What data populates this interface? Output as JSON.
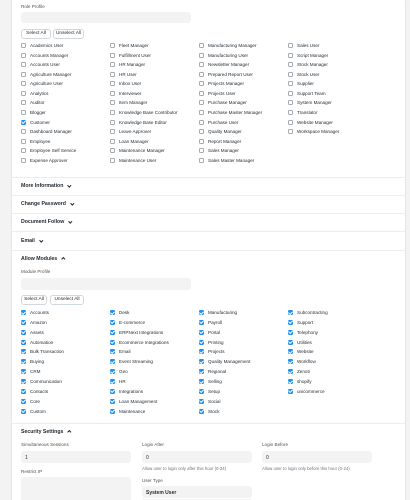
{
  "role_profile": {
    "label": "Role Profile",
    "value": ""
  },
  "role_buttons": {
    "select_all": "Select All",
    "unselect_all": "Unselect All"
  },
  "roles": [
    [
      {
        "label": "Academics User",
        "checked": false
      },
      {
        "label": "Accounts Manager",
        "checked": false
      },
      {
        "label": "Accounts User",
        "checked": false
      },
      {
        "label": "Agriculture Manager",
        "checked": false
      },
      {
        "label": "Agriculture User",
        "checked": false
      },
      {
        "label": "Analytics",
        "checked": false
      },
      {
        "label": "Auditor",
        "checked": false
      },
      {
        "label": "Blogger",
        "checked": false
      },
      {
        "label": "Customer",
        "checked": true
      },
      {
        "label": "Dashboard Manager",
        "checked": false
      },
      {
        "label": "Employee",
        "checked": false
      },
      {
        "label": "Employee Self Service",
        "checked": false
      },
      {
        "label": "Expense Approver",
        "checked": false
      }
    ],
    [
      {
        "label": "Fleet Manager",
        "checked": false
      },
      {
        "label": "Fulfillment User",
        "checked": false
      },
      {
        "label": "HR Manager",
        "checked": false
      },
      {
        "label": "HR User",
        "checked": false
      },
      {
        "label": "Inbox User",
        "checked": false
      },
      {
        "label": "Interviewer",
        "checked": false
      },
      {
        "label": "Item Manager",
        "checked": false
      },
      {
        "label": "Knowledge Base Contributor",
        "checked": false
      },
      {
        "label": "Knowledge Base Editor",
        "checked": false
      },
      {
        "label": "Leave Approver",
        "checked": false
      },
      {
        "label": "Loan Manager",
        "checked": false
      },
      {
        "label": "Maintenance Manager",
        "checked": false
      },
      {
        "label": "Maintenance User",
        "checked": false
      }
    ],
    [
      {
        "label": "Manufacturing Manager",
        "checked": false
      },
      {
        "label": "Manufacturing User",
        "checked": false
      },
      {
        "label": "Newsletter Manager",
        "checked": false
      },
      {
        "label": "Prepared Report User",
        "checked": false
      },
      {
        "label": "Projects Manager",
        "checked": false
      },
      {
        "label": "Projects User",
        "checked": false
      },
      {
        "label": "Purchase Manager",
        "checked": false
      },
      {
        "label": "Purchase Master Manager",
        "checked": false
      },
      {
        "label": "Purchase User",
        "checked": false
      },
      {
        "label": "Quality Manager",
        "checked": false
      },
      {
        "label": "Report Manager",
        "checked": false
      },
      {
        "label": "Sales Manager",
        "checked": false
      },
      {
        "label": "Sales Master Manager",
        "checked": false
      }
    ],
    [
      {
        "label": "Sales User",
        "checked": false
      },
      {
        "label": "Script Manager",
        "checked": false
      },
      {
        "label": "Stock Manager",
        "checked": false
      },
      {
        "label": "Stock User",
        "checked": false
      },
      {
        "label": "Supplier",
        "checked": false
      },
      {
        "label": "Support Team",
        "checked": false
      },
      {
        "label": "System Manager",
        "checked": false
      },
      {
        "label": "Translator",
        "checked": false
      },
      {
        "label": "Website Manager",
        "checked": false
      },
      {
        "label": "Workspace Manager",
        "checked": false
      }
    ]
  ],
  "sections": {
    "more_information": "More Information",
    "change_password": "Change Password",
    "document_follow": "Document Follow",
    "email": "Email",
    "allow_modules": "Allow Modules",
    "security_settings": "Security Settings"
  },
  "module_profile": {
    "label": "Module Profile",
    "value": ""
  },
  "module_buttons": {
    "select_all": "Select All",
    "unselect_all": "Unselect All"
  },
  "modules": [
    [
      {
        "label": "Accounts",
        "checked": true
      },
      {
        "label": "Amazon",
        "checked": true
      },
      {
        "label": "Assets",
        "checked": true
      },
      {
        "label": "Automation",
        "checked": true
      },
      {
        "label": "Bulk Transaction",
        "checked": true
      },
      {
        "label": "Buying",
        "checked": true
      },
      {
        "label": "CRM",
        "checked": true
      },
      {
        "label": "Communication",
        "checked": true
      },
      {
        "label": "Contacts",
        "checked": true
      },
      {
        "label": "Core",
        "checked": true
      },
      {
        "label": "Custom",
        "checked": true
      }
    ],
    [
      {
        "label": "Desk",
        "checked": true
      },
      {
        "label": "E-commerce",
        "checked": true
      },
      {
        "label": "ERPNext Integrations",
        "checked": true
      },
      {
        "label": "Ecommerce Integrations",
        "checked": true
      },
      {
        "label": "Email",
        "checked": true
      },
      {
        "label": "Event Streaming",
        "checked": true
      },
      {
        "label": "Geo",
        "checked": true
      },
      {
        "label": "HR",
        "checked": true
      },
      {
        "label": "Integrations",
        "checked": true
      },
      {
        "label": "Loan Management",
        "checked": true
      },
      {
        "label": "Maintenance",
        "checked": true
      }
    ],
    [
      {
        "label": "Manufacturing",
        "checked": true
      },
      {
        "label": "Payroll",
        "checked": true
      },
      {
        "label": "Portal",
        "checked": true
      },
      {
        "label": "Printing",
        "checked": true
      },
      {
        "label": "Projects",
        "checked": true
      },
      {
        "label": "Quality Management",
        "checked": true
      },
      {
        "label": "Regional",
        "checked": true
      },
      {
        "label": "Selling",
        "checked": true
      },
      {
        "label": "Setup",
        "checked": true
      },
      {
        "label": "Social",
        "checked": true
      },
      {
        "label": "Stock",
        "checked": true
      }
    ],
    [
      {
        "label": "Subcontracting",
        "checked": true
      },
      {
        "label": "Support",
        "checked": true
      },
      {
        "label": "Telephony",
        "checked": true
      },
      {
        "label": "Utilities",
        "checked": true
      },
      {
        "label": "Website",
        "checked": true
      },
      {
        "label": "Workflow",
        "checked": true
      },
      {
        "label": "Zenoti",
        "checked": true
      },
      {
        "label": "shopify",
        "checked": true
      },
      {
        "label": "unicommerce",
        "checked": true
      }
    ]
  ],
  "security": {
    "simultaneous_sessions": {
      "label": "Simultaneous Sessions",
      "value": "1"
    },
    "login_after": {
      "label": "Login After",
      "value": "0",
      "help": "Allow user to login only after this hour (0-24)"
    },
    "login_before": {
      "label": "Login Before",
      "value": "0",
      "help": "Allow user to login only before this hour (0-24)"
    },
    "restrict_ip": {
      "label": "Restrict IP",
      "value": ""
    },
    "user_type": {
      "label": "User Type",
      "value": "System User"
    }
  },
  "colors": {
    "accent": "#2490ef",
    "field_bg": "#f3f3f3"
  }
}
